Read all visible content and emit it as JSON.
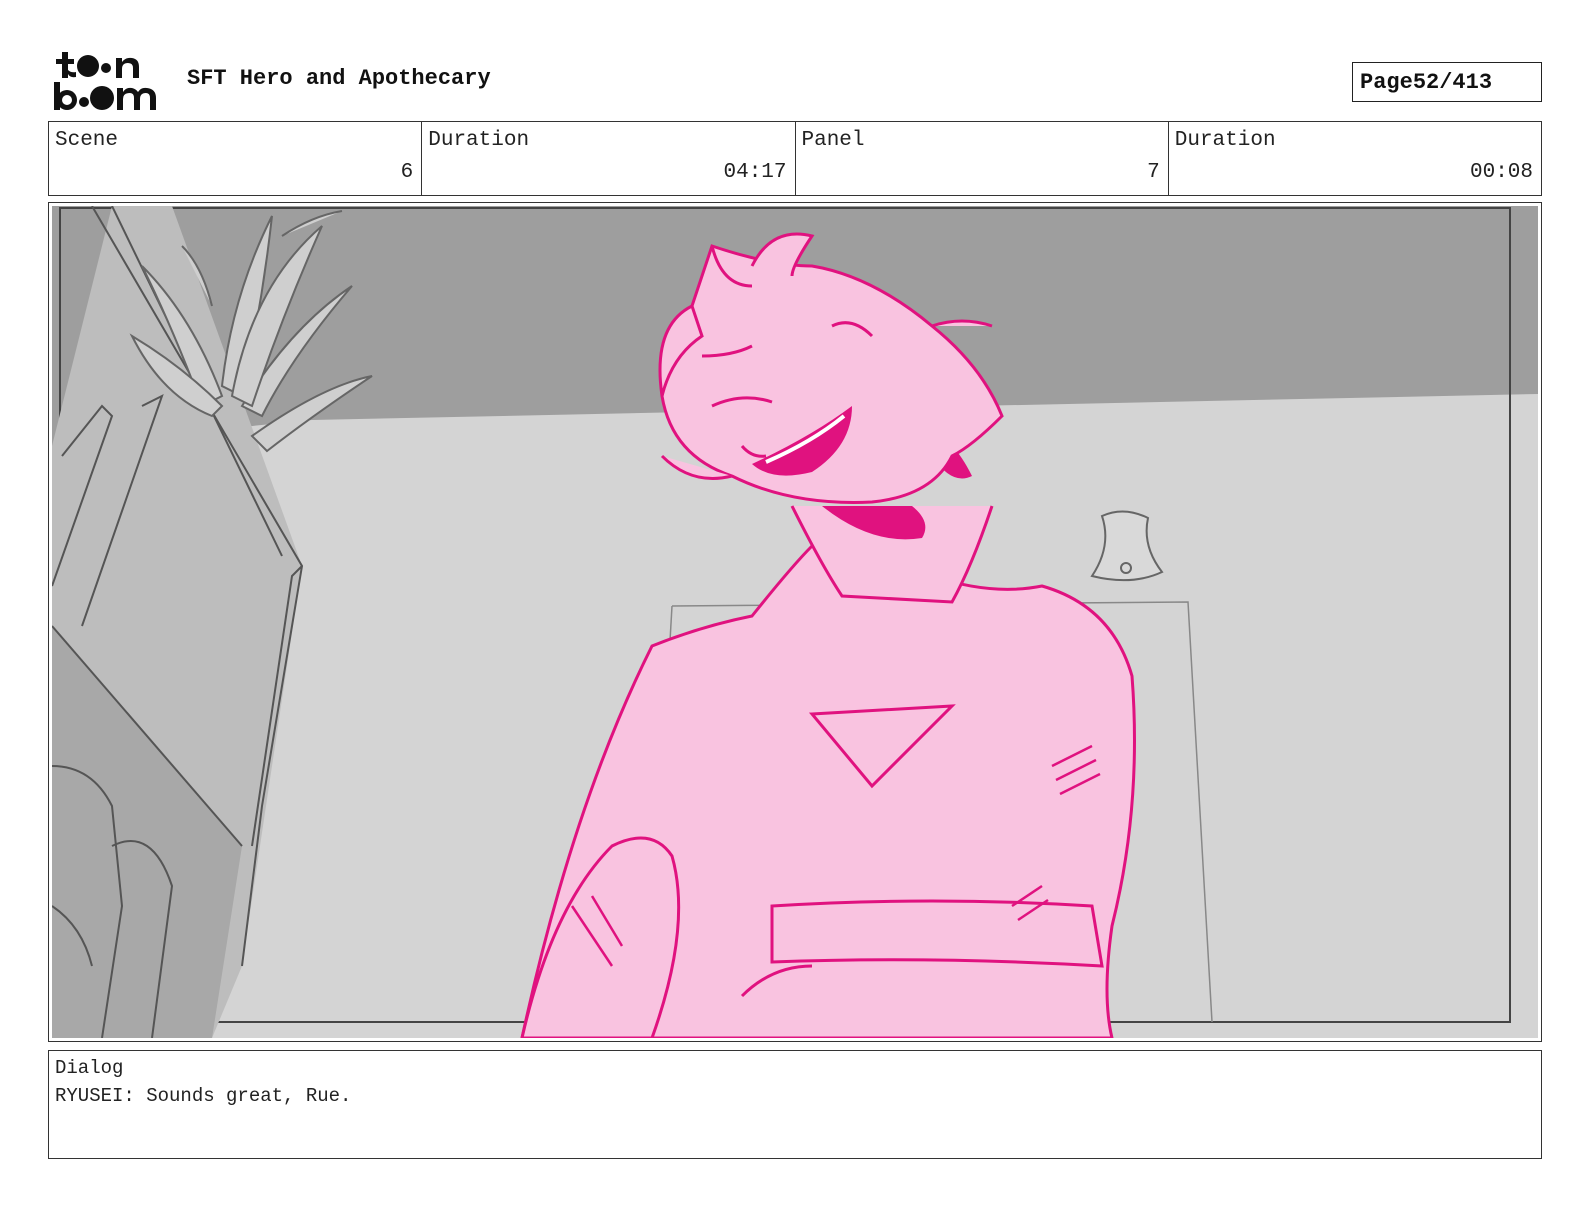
{
  "header": {
    "logo": {
      "line1": "toon",
      "line2": "boom",
      "icon": "toon-boom-logo"
    },
    "project_title": "SFT Hero and Apothecary",
    "page": {
      "label": "Page",
      "current": "52",
      "total": "413",
      "text": "52/413"
    }
  },
  "info": {
    "scene_label": "Scene",
    "scene_value": "6",
    "scene_duration_label": "Duration",
    "scene_duration_value": "04:17",
    "panel_label": "Panel",
    "panel_value": "7",
    "panel_duration_label": "Duration",
    "panel_duration_value": "00:08"
  },
  "panel_image": {
    "subject": "storyboard-sketch-character-smiling",
    "colors": {
      "character": "#e0127f",
      "character_fill": "#f9c3e0",
      "ceiling": "#9e9e9e",
      "wall": "#d4d4d4",
      "shelf": "#bdbdbd",
      "sketch_line": "#555555"
    }
  },
  "dialog": {
    "label": "Dialog",
    "text": "RYUSEI: Sounds great, Rue."
  }
}
